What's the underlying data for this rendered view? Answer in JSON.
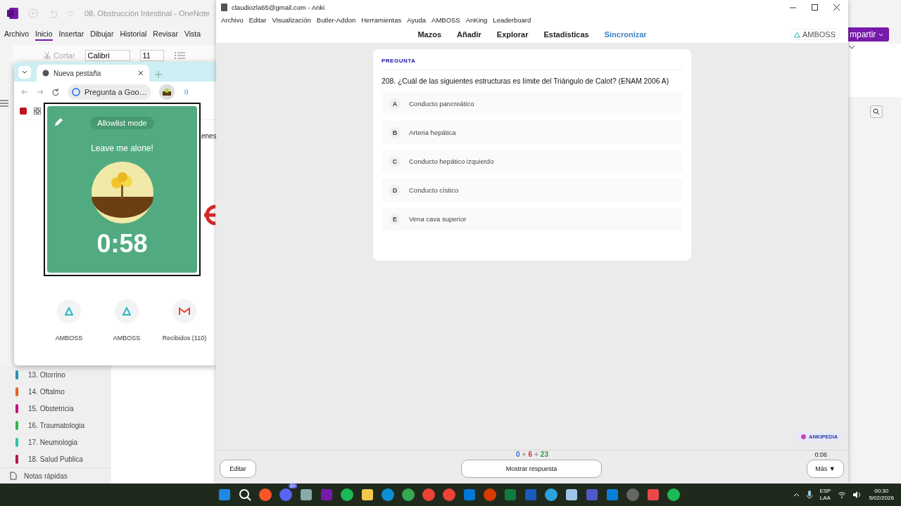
{
  "onenote": {
    "title": "08. Obstrucción Intestinal - OneNote",
    "tabs": [
      {
        "label": "Archivo",
        "selected": false
      },
      {
        "label": "Inicio",
        "selected": true
      },
      {
        "label": "Insertar",
        "selected": false
      },
      {
        "label": "Dibujar",
        "selected": false
      },
      {
        "label": "Historial",
        "selected": false
      },
      {
        "label": "Revisar",
        "selected": false
      },
      {
        "label": "Vista",
        "selected": false
      }
    ],
    "cut_label": "Cortar",
    "font": "Calibri",
    "font_size": "11",
    "share_button": "mpartir",
    "sections": [
      {
        "label": "13. Otorrino",
        "color": "#2a8fb5"
      },
      {
        "label": "14. Oftalmo",
        "color": "#e0622a"
      },
      {
        "label": "15. Obstetricia",
        "color": "#c0157a"
      },
      {
        "label": "16. Traumatologia",
        "color": "#2db54a"
      },
      {
        "label": "17. Neumologia",
        "color": "#2ec4b0"
      },
      {
        "label": "18. Salud Publica",
        "color": "#b0164a"
      }
    ],
    "quick_notes": "Notas rápidas"
  },
  "browser": {
    "tab": "Nueva pestaña",
    "omnibox": "Pregunta a Goo…",
    "page_fragment": "enes",
    "shortcuts": [
      {
        "label": "AMBOSS",
        "kind": "amboss"
      },
      {
        "label": "AMBOSS",
        "kind": "amboss"
      },
      {
        "label": "Recibidos (110)",
        "kind": "mail"
      }
    ]
  },
  "focus_popup": {
    "mode": "Allowlist mode",
    "message": "Leave me alone!",
    "timer": "0:58"
  },
  "anki": {
    "title": "claudiozla65@gmail.com - Anki",
    "menu": [
      "Archivo",
      "Editar",
      "Visualización",
      "Butler-Addon",
      "Herramientas",
      "Ayuda",
      "AMBOSS",
      "AnKing",
      "Leaderboard"
    ],
    "toolbar": [
      {
        "label": "Mazos",
        "highlighted": false
      },
      {
        "label": "Añadir",
        "highlighted": false
      },
      {
        "label": "Explorar",
        "highlighted": false
      },
      {
        "label": "Estadísticas",
        "highlighted": false
      },
      {
        "label": "Sincronizar",
        "highlighted": true
      }
    ],
    "brand": "AMBOSS",
    "card": {
      "label": "PREGUNTA",
      "question": "208. ¿Cuál de las siguientes estructuras es límite del Triángulo de Calot? (ENAM 2006 A)",
      "options": [
        {
          "letter": "A",
          "text": "Conducto pancreático"
        },
        {
          "letter": "B",
          "text": "Arteria hepática"
        },
        {
          "letter": "C",
          "text": "Conducto hepático izquierdo"
        },
        {
          "letter": "D",
          "text": "Conducto cístico"
        },
        {
          "letter": "E",
          "text": "Vena cava superior"
        }
      ]
    },
    "ankipedia": "ANKIPEDIA",
    "counts": [
      {
        "kind": "count",
        "text": "0",
        "color": "#3b6fe0"
      },
      {
        "kind": "separator",
        "text": "+"
      },
      {
        "kind": "count",
        "text": "6",
        "color": "#d93030"
      },
      {
        "kind": "separator",
        "text": "+"
      },
      {
        "kind": "count",
        "text": "23",
        "color": "#2e9e44"
      }
    ],
    "timer": "0:06",
    "edit_button": "Editar",
    "show_button": "Mostrar respuesta",
    "more_button": "Más ▼"
  },
  "taskbar": {
    "badge": "9+",
    "language": "ESP",
    "layout": "LAA",
    "time": "00:30",
    "date": "5/02/2026"
  }
}
